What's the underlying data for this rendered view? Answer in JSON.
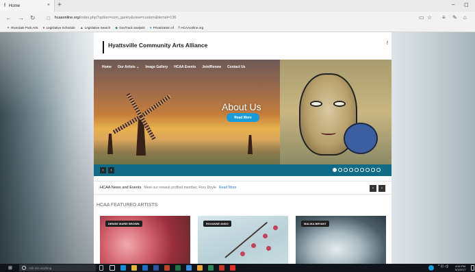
{
  "browser": {
    "tab_title": "Home",
    "tab_favicon": "f",
    "tab_close": "×",
    "new_tab": "+",
    "url_host": "hcaaonline.org",
    "url_path": "/index.php?option=com_gantry&view=custom&itemid=136",
    "window_min": "–",
    "window_max": "◻",
    "nav": {
      "back": "←",
      "forward": "→",
      "refresh": "↻"
    },
    "favorites": [
      {
        "icon": "✦",
        "label": "Riverdale Park Arts"
      },
      {
        "icon": "●",
        "label": "Legislative Schedule"
      },
      {
        "icon": "▲",
        "label": "Legislative Search"
      },
      {
        "icon": "◆",
        "label": "GovTrack analysis"
      },
      {
        "icon": "●",
        "label": "Privatization of"
      },
      {
        "icon": "f",
        "label": "HCAAonline.org"
      }
    ],
    "toolbar_icons": [
      "reading-view-icon",
      "favorites-star-icon",
      "hub-icon",
      "notes-icon",
      "share-icon"
    ]
  },
  "site": {
    "logo_text": "Hyattsville Community Arts Alliance",
    "facebook_icon": "f",
    "nav": [
      "Home",
      "Our Artists ⌄",
      "Image Gallery",
      "HCAA Events",
      "Join/Renew",
      "Contact Us"
    ],
    "hero": {
      "title": "About Us",
      "button": "Read More",
      "prev": "‹",
      "next": "›",
      "slide_count": 9,
      "active_slide": 1
    },
    "news": {
      "label": "HCAA News and Events",
      "text": "Meet our newest profiled member, Rory Doyle",
      "link": "Read More",
      "prev": "‹",
      "next": "›"
    },
    "featured_title": "HCAA FEATURED ARTISTS",
    "artists": [
      "DENISE MARIE BROWN",
      "ROXANNE ANDO",
      "MALIKA BRYANT"
    ]
  },
  "taskbar": {
    "search_placeholder": "Ask me anything",
    "time": "4:54 PM",
    "date": "5/3/2017"
  }
}
